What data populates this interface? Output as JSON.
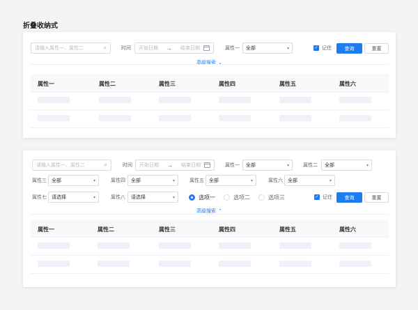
{
  "page_title": "折叠收纳式",
  "common": {
    "search_placeholder": "请输入属性一、属性二",
    "time_label": "时间",
    "date_start": "开始日期",
    "date_end": "结束日期",
    "date_arrow": "→",
    "remember_label": "记住",
    "query_label": "查询",
    "reset_label": "重置",
    "all": "全部",
    "please_select": "请选择"
  },
  "card1": {
    "attr1_label": "属性一",
    "attr1_value": "全部",
    "advanced_label": "高级搜索",
    "advanced_chevron": "⌄"
  },
  "card2": {
    "advanced_label": "高级搜索",
    "advanced_chevron": "⌃",
    "row1": [
      {
        "label": "属性一",
        "value": "全部"
      },
      {
        "label": "属性二",
        "value": "全部"
      }
    ],
    "row2": [
      {
        "label": "属性三",
        "value": "全部"
      },
      {
        "label": "属性四",
        "value": "全部"
      },
      {
        "label": "属性五",
        "value": "全部"
      },
      {
        "label": "属性六",
        "value": "全部"
      }
    ],
    "row3": [
      {
        "label": "属性七",
        "value": "请选择"
      },
      {
        "label": "属性八",
        "value": "请选择"
      }
    ],
    "radios": [
      {
        "label": "选项一",
        "checked": true
      },
      {
        "label": "选项二",
        "checked": false
      },
      {
        "label": "选项三",
        "checked": false
      }
    ]
  },
  "table": {
    "columns": [
      "属性一",
      "属性二",
      "属性三",
      "属性四",
      "属性五",
      "属性六"
    ]
  },
  "colors": {
    "accent": "#1e7cf2",
    "skeleton": "#eef1f9",
    "header_bg": "#f7f8fa"
  },
  "icons": {
    "search": "search-icon",
    "calendar": "calendar-icon",
    "chevron": "chevron-down-icon",
    "check": "check-icon"
  }
}
